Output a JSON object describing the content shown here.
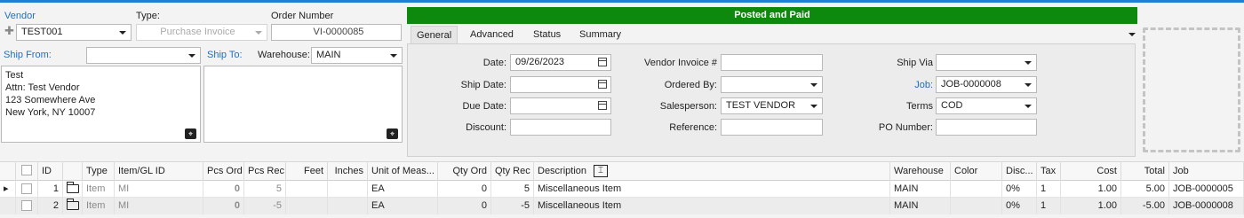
{
  "vendor": {
    "label": "Vendor",
    "value": "TEST001"
  },
  "type": {
    "label": "Type:",
    "value": "Purchase Invoice"
  },
  "order_number": {
    "label": "Order Number",
    "value": "VI-0000085"
  },
  "ship_from": {
    "label": "Ship From:",
    "value": "",
    "address": [
      "Test",
      "Attn: Test Vendor",
      "123 Somewhere Ave",
      "New York, NY 10007"
    ]
  },
  "ship_to": {
    "label": "Ship To:",
    "warehouse_label": "Warehouse:",
    "warehouse_value": "MAIN"
  },
  "status_banner": "Posted and Paid",
  "tabs": [
    "General",
    "Advanced",
    "Status",
    "Summary"
  ],
  "general": {
    "date_label": "Date:",
    "date_value": "09/26/2023",
    "ship_date_label": "Ship Date:",
    "ship_date_value": "",
    "due_date_label": "Due Date:",
    "due_date_value": "",
    "discount_label": "Discount:",
    "discount_value": "",
    "vendor_invoice_label": "Vendor Invoice #",
    "vendor_invoice_value": "",
    "ordered_by_label": "Ordered By:",
    "ordered_by_value": "",
    "salesperson_label": "Salesperson:",
    "salesperson_value": "TEST VENDOR",
    "reference_label": "Reference:",
    "reference_value": "",
    "ship_via_label": "Ship Via",
    "ship_via_value": "",
    "job_label": "Job:",
    "job_value": "JOB-0000008",
    "terms_label": "Terms",
    "terms_value": "COD",
    "po_number_label": "PO Number:",
    "po_number_value": ""
  },
  "grid": {
    "columns": [
      "ID",
      "Type",
      "Item/GL ID",
      "Pcs Ord",
      "Pcs Rec",
      "Feet",
      "Inches",
      "Unit of Meas...",
      "Qty Ord",
      "Qty Rec",
      "Description",
      "Warehouse",
      "Color",
      "Disc...",
      "Tax",
      "Cost",
      "Total",
      "Job"
    ],
    "rows": [
      {
        "id": "1",
        "type": "Item",
        "item": "MI",
        "pcs_ord": "0",
        "pcs_rec": "5",
        "feet": "",
        "inches": "",
        "uom": "EA",
        "qty_ord": "0",
        "qty_rec": "5",
        "description": "Miscellaneous Item",
        "warehouse": "MAIN",
        "color": "",
        "disc": "0%",
        "tax": "1",
        "cost": "1.00",
        "total": "5.00",
        "job": "JOB-0000005"
      },
      {
        "id": "2",
        "type": "Item",
        "item": "MI",
        "pcs_ord": "0",
        "pcs_rec": "-5",
        "feet": "",
        "inches": "",
        "uom": "EA",
        "qty_ord": "0",
        "qty_rec": "-5",
        "description": "Miscellaneous Item",
        "warehouse": "MAIN",
        "color": "",
        "disc": "0%",
        "tax": "1",
        "cost": "1.00",
        "total": "-5.00",
        "job": "JOB-0000008"
      }
    ]
  },
  "icons": {
    "add": "plus-icon",
    "map": "map-pin-icon",
    "calendar": "calendar-icon",
    "folder": "folder-icon",
    "row_pointer": "row-pointer-icon",
    "column_resize": "column-resize-icon"
  },
  "colors": {
    "banner": "#0d8a0d",
    "link": "#1f6fbf",
    "accent": "#1e7fd4"
  }
}
